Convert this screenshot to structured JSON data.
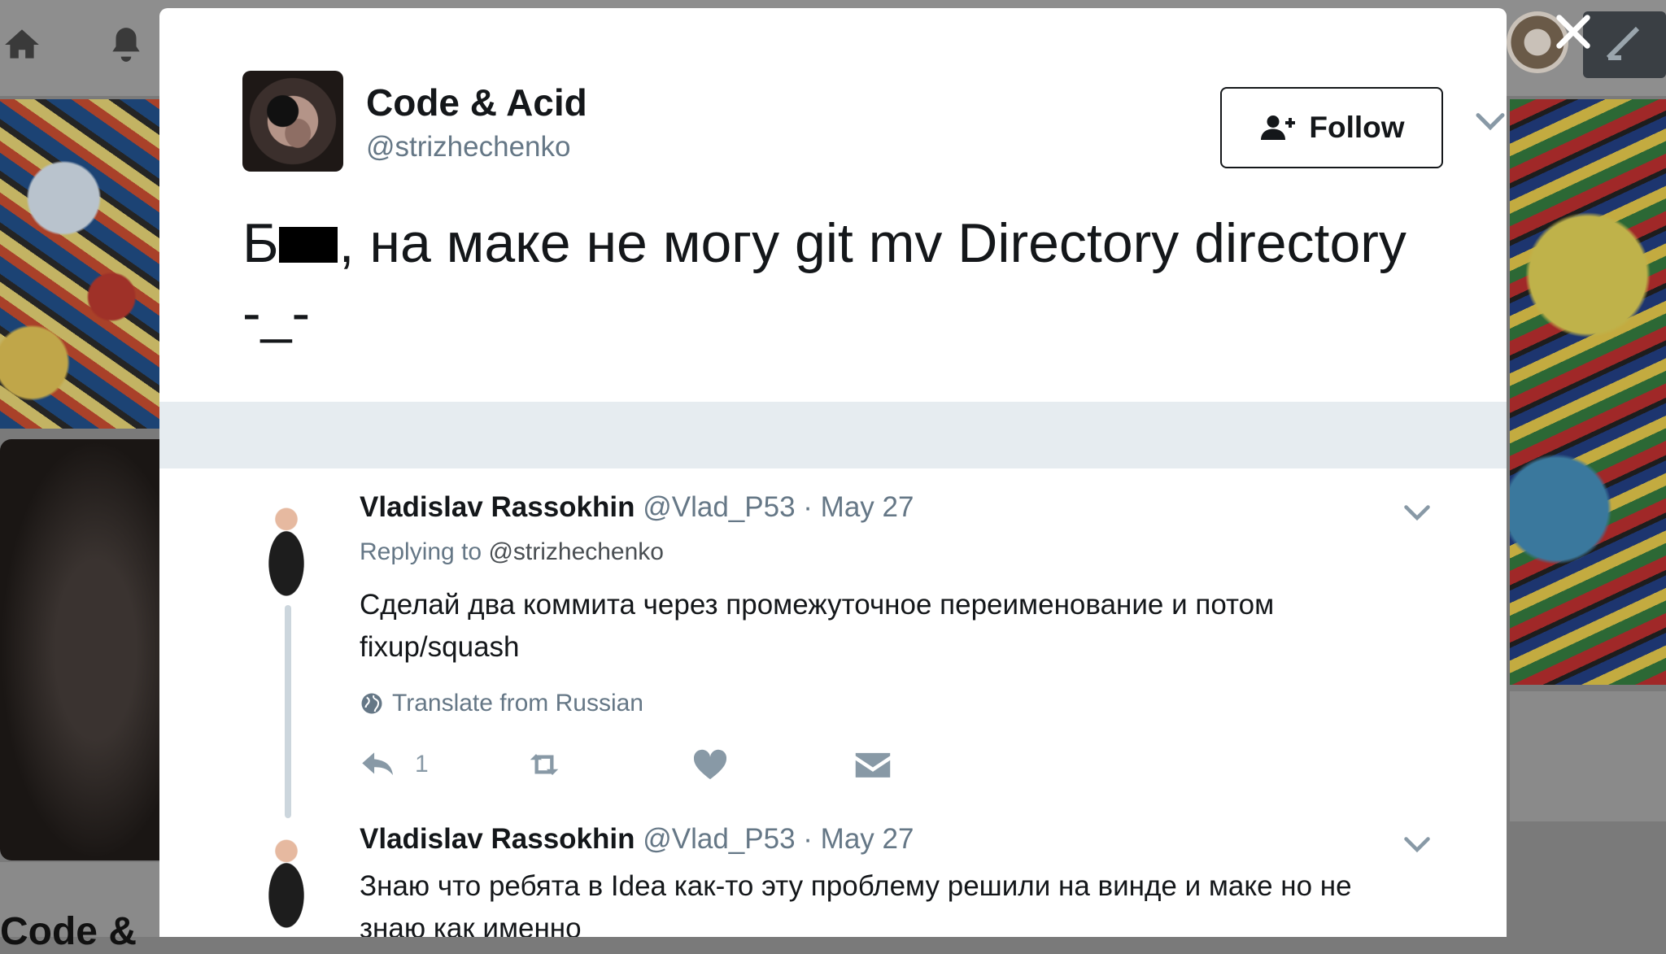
{
  "tweet": {
    "author_name": "Code & Acid",
    "author_handle": "@strizhechenko",
    "follow_label": "Follow",
    "text_first": "Б",
    "text_rest": ", на маке не могу git mv Directory directory",
    "text_line2": "-_-"
  },
  "replies": [
    {
      "name": "Vladislav Rassokhin",
      "handle": "@Vlad_P53",
      "dot": "·",
      "date": "May 27",
      "replying_prefix": "Replying to",
      "replying_to": "@strizhechenko",
      "text": "Сделай два коммита через промежуточное переименование и потом fixup/squash",
      "translate_label": "Translate from Russian",
      "reply_count": "1"
    },
    {
      "name": "Vladislav Rassokhin",
      "handle": "@Vlad_P53",
      "dot": "·",
      "date": "May 27",
      "text": "Знаю что ребята в Idea как-то эту проблему решили на винде и маке но не знаю как именно"
    }
  ],
  "background": {
    "profile_name_fragment": "Code &"
  },
  "colors": {
    "text_primary": "#14171a",
    "text_secondary": "#657786",
    "action_gray": "#8899a6",
    "divider": "#e6ecf0"
  }
}
